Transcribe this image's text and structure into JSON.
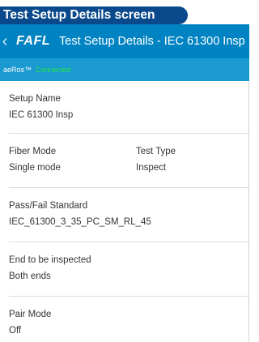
{
  "caption": "Test Setup Details screen",
  "header": {
    "back_glyph": "‹",
    "brand": "FAFL",
    "title": "Test Setup Details - IEC 61300 Insp"
  },
  "status_bar": {
    "brand": "aeRos™",
    "connection": "Connected"
  },
  "details": {
    "setup_name": {
      "label": "Setup Name",
      "value": "IEC 61300 Insp"
    },
    "fiber_mode": {
      "label": "Fiber Mode",
      "value": "Single mode"
    },
    "test_type": {
      "label": "Test Type",
      "value": "Inspect"
    },
    "pass_fail_standard": {
      "label": "Pass/Fail Standard",
      "value": "IEC_61300_3_35_PC_SM_RL_45"
    },
    "end_to_inspect": {
      "label": "End to be inspected",
      "value": "Both ends"
    },
    "pair_mode": {
      "label": "Pair Mode",
      "value": "Off"
    }
  },
  "colors": {
    "caption_bg": "#0a4a8c",
    "titlebar_bg": "#0083c2",
    "statusbar_bg": "#1a9ad0",
    "connected_text": "#27e04a",
    "pointer_arrow": "#d8232a"
  },
  "icons": {
    "back": "chevron-left-icon",
    "pointer": "pointer-arrow-icon"
  }
}
